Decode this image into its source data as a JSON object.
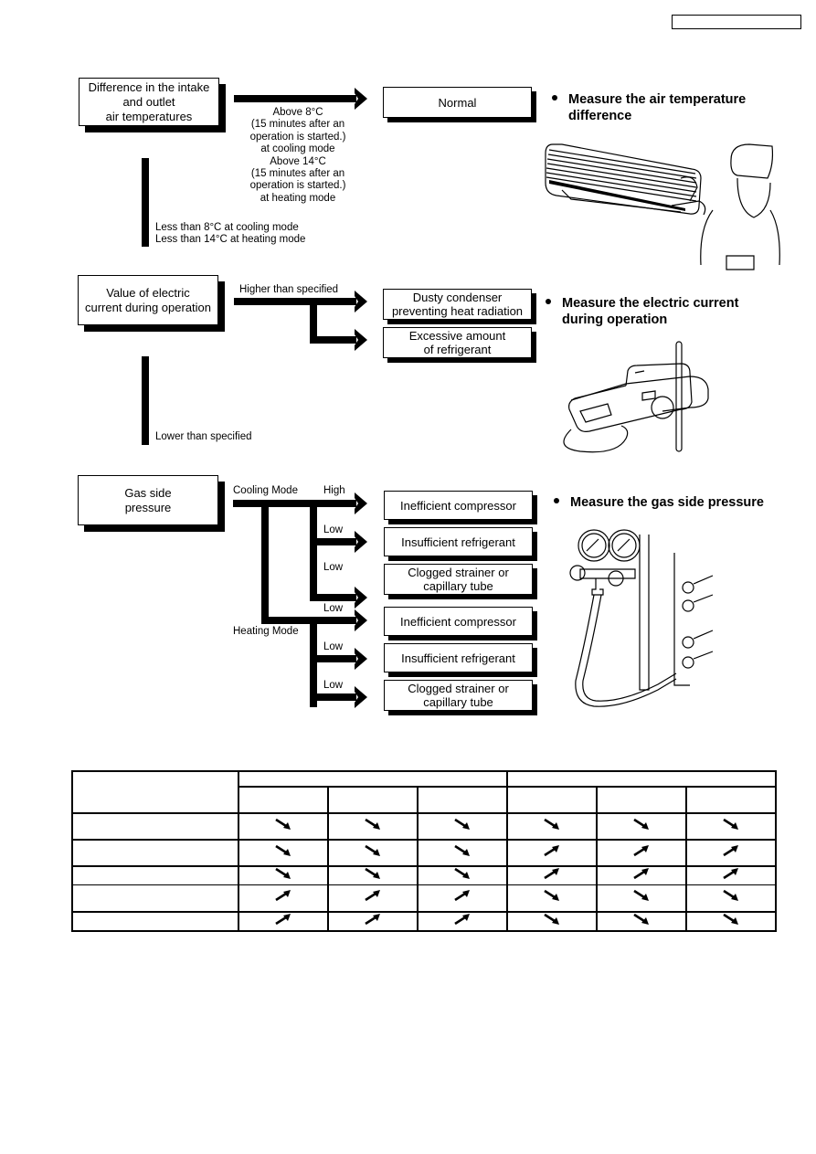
{
  "header": {
    "label": ""
  },
  "section1": {
    "check_box": [
      "Difference in the intake",
      "and outlet",
      "air temperatures"
    ],
    "above_condition": [
      "Above 8°C",
      "(15 minutes after an",
      "operation is started.)",
      "at cooling mode",
      "Above 14°C",
      "(15 minutes after an",
      "operation is started.)",
      "at heating mode"
    ],
    "below_condition": [
      "Less than 8°C at cooling mode",
      "Less than 14°C at heating mode"
    ],
    "result": "Normal",
    "instruction": [
      "Measure the air temperature",
      "difference"
    ],
    "illustration": "technician-measuring-indoor-unit"
  },
  "section2": {
    "check_box": [
      "Value of electric",
      "current during operation"
    ],
    "higher_label": "Higher than specified",
    "lower_label": "Lower than specified",
    "results": [
      [
        "Dusty condenser",
        "preventing heat radiation"
      ],
      [
        "Excessive amount",
        "of refrigerant"
      ]
    ],
    "instruction": [
      "Measure the electric current",
      "during operation"
    ],
    "illustration": "clamp-meter"
  },
  "section3": {
    "check_box": [
      "Gas side",
      "pressure"
    ],
    "cooling_mode_label": "Cooling Mode",
    "heating_mode_label": "Heating Mode",
    "instruction": [
      "Measure the gas side pressure"
    ],
    "illustration": "gauge-manifold",
    "cooling_branches": [
      {
        "level": "High",
        "result": [
          "Inefficient compressor"
        ]
      },
      {
        "level": "Low",
        "result": [
          "Insufficient refrigerant"
        ]
      },
      {
        "level": "Low",
        "result": [
          "Clogged strainer or",
          "capillary tube"
        ]
      }
    ],
    "heating_branches": [
      {
        "level": "Low",
        "result": [
          "Inefficient compressor"
        ]
      },
      {
        "level": "Low",
        "result": [
          "Insufficient refrigerant"
        ]
      },
      {
        "level": "Low",
        "result": [
          "Clogged strainer or",
          "capillary tube"
        ]
      }
    ]
  },
  "table": {
    "group_headers": [
      "",
      ""
    ],
    "sub_headers": [
      "",
      "",
      "",
      "",
      "",
      ""
    ],
    "rows": [
      {
        "label": "",
        "trends": [
          "down",
          "down",
          "down",
          "down",
          "down",
          "down"
        ]
      },
      {
        "label": "",
        "trends": [
          "down",
          "down",
          "down",
          "up",
          "up",
          "up"
        ]
      },
      {
        "label": "",
        "trends": [
          "down",
          "down",
          "down",
          "up",
          "up",
          "up"
        ]
      },
      {
        "label": "",
        "trends": [
          "up",
          "up",
          "up",
          "down",
          "down",
          "down"
        ]
      },
      {
        "label": "",
        "trends": [
          "up",
          "up",
          "up",
          "down",
          "down",
          "down"
        ]
      }
    ]
  }
}
